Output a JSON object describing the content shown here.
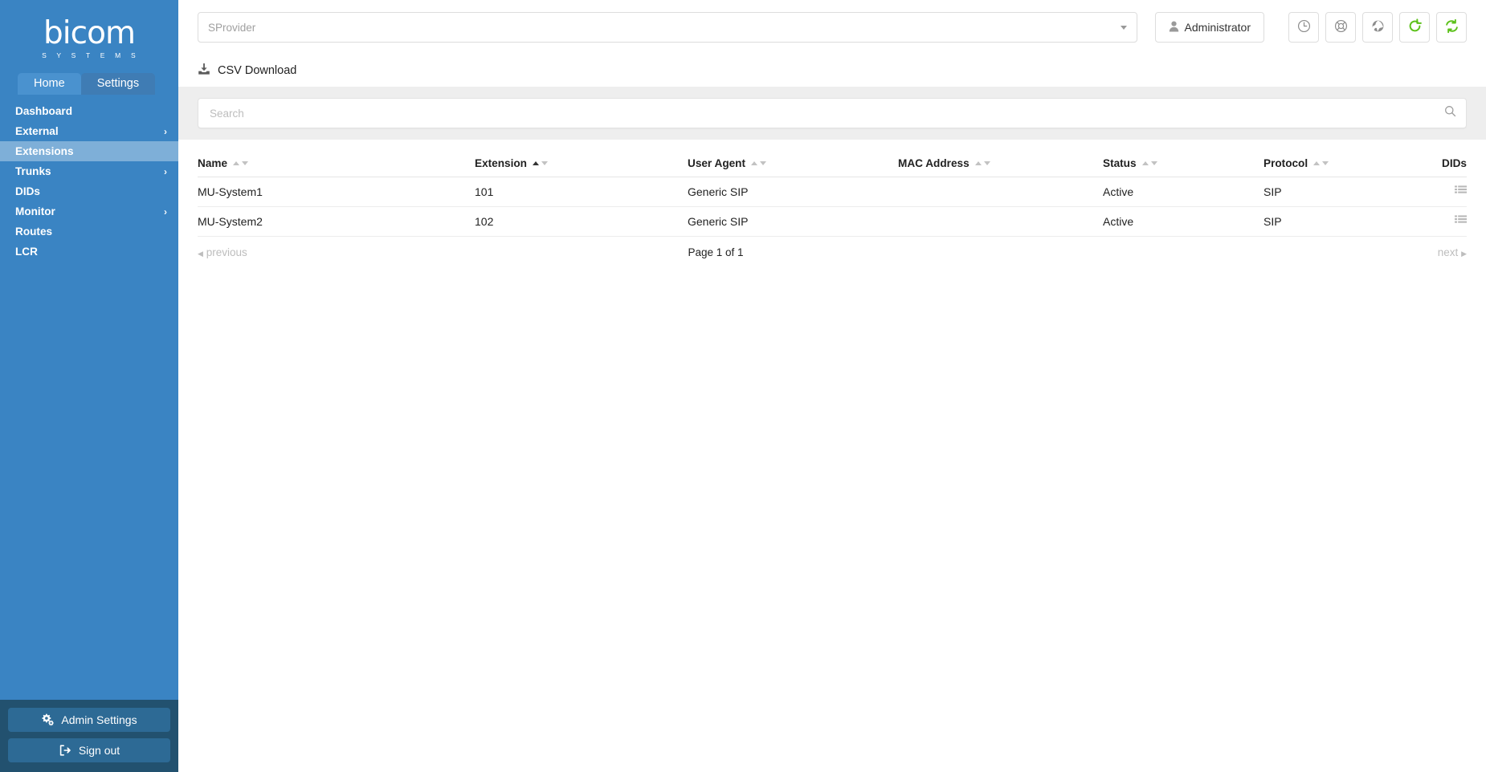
{
  "brand": {
    "logo_word": "bicom",
    "logo_sub": "S Y S T E M S",
    "sidebar_color": "#3a84c3",
    "accent_color": "#7eafd8",
    "bottom_color": "#22516f",
    "green_icon_color": "#5cc11a"
  },
  "tabs": [
    {
      "label": "Home",
      "active": true
    },
    {
      "label": "Settings",
      "active": false
    }
  ],
  "sidebar": {
    "items": [
      {
        "label": "Dashboard",
        "chevron": false,
        "active": false
      },
      {
        "label": "External",
        "chevron": true,
        "active": false
      },
      {
        "label": "Extensions",
        "chevron": false,
        "active": true
      },
      {
        "label": "Trunks",
        "chevron": true,
        "active": false
      },
      {
        "label": "DIDs",
        "chevron": false,
        "active": false
      },
      {
        "label": "Monitor",
        "chevron": true,
        "active": false
      },
      {
        "label": "Routes",
        "chevron": false,
        "active": false
      },
      {
        "label": "LCR",
        "chevron": false,
        "active": false
      }
    ],
    "buttons": [
      {
        "label": "Admin Settings",
        "icon": "gears-icon"
      },
      {
        "label": "Sign out",
        "icon": "sign-out-icon"
      }
    ],
    "chevron_glyph": "›"
  },
  "topbar": {
    "provider_select": {
      "value": "SProvider",
      "placeholder": "SProvider"
    },
    "user_button": {
      "label": "Administrator",
      "icon": "user-icon"
    },
    "icon_buttons": [
      {
        "name": "clock-icon",
        "title": ""
      },
      {
        "name": "lifebuoy-icon",
        "title": ""
      },
      {
        "name": "globe-icon",
        "title": ""
      },
      {
        "name": "reload-icon",
        "title": ""
      },
      {
        "name": "sync-icon",
        "title": ""
      }
    ]
  },
  "toolbar": {
    "csv_download_label": "CSV Download",
    "csv_icon": "download-icon"
  },
  "search": {
    "placeholder": "Search",
    "value": "",
    "icon": "search-icon"
  },
  "table": {
    "columns": [
      {
        "label": "Name",
        "sortable": true,
        "sorted": "none"
      },
      {
        "label": "Extension",
        "sortable": true,
        "sorted": "asc"
      },
      {
        "label": "User Agent",
        "sortable": true,
        "sorted": "none"
      },
      {
        "label": "MAC Address",
        "sortable": true,
        "sorted": "none"
      },
      {
        "label": "Status",
        "sortable": true,
        "sorted": "none"
      },
      {
        "label": "Protocol",
        "sortable": true,
        "sorted": "none"
      },
      {
        "label": "DIDs",
        "sortable": false,
        "sorted": "none"
      }
    ],
    "rows": [
      {
        "name": "MU-System1",
        "extension": "101",
        "user_agent": "Generic SIP",
        "mac_address": "",
        "status": "Active",
        "protocol": "SIP",
        "dids_icon": "list-icon"
      },
      {
        "name": "MU-System2",
        "extension": "102",
        "user_agent": "Generic SIP",
        "mac_address": "",
        "status": "Active",
        "protocol": "SIP",
        "dids_icon": "list-icon"
      }
    ]
  },
  "pagination": {
    "previous_label": "previous",
    "next_label": "next",
    "page_text": "Page 1 of 1",
    "prev_glyph": "◀",
    "next_glyph": "▶"
  }
}
